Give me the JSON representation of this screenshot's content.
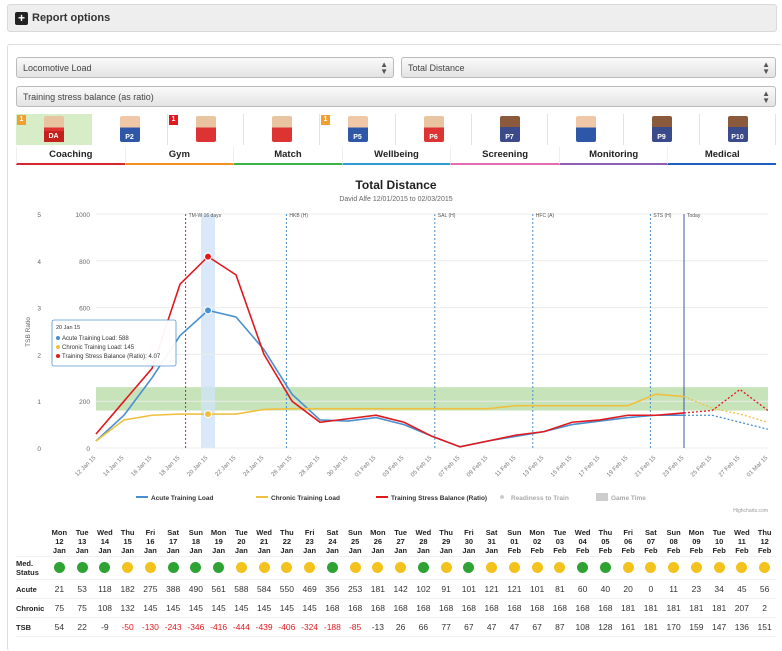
{
  "report_options": {
    "label": "Report options"
  },
  "selectors": {
    "metric": "Locomotive Load",
    "submetric": "Total Distance",
    "analysis": "Training stress balance (as ratio)"
  },
  "players": [
    {
      "badge": "1",
      "badge_color": "#f0a030",
      "tag": "DA",
      "skin": "lt"
    },
    {
      "badge": "",
      "tag": "",
      "num": "P2",
      "skin": "wb"
    },
    {
      "badge": "1",
      "badge_color": "#e0191f",
      "tag": "",
      "num": "",
      "skin": "lt"
    },
    {
      "badge": "",
      "tag": "",
      "num": "",
      "skin": "lt"
    },
    {
      "badge": "1",
      "badge_color": "#f0a030",
      "tag": "",
      "num": "P5",
      "skin": "wb"
    },
    {
      "badge": "",
      "tag": "",
      "num": "P6",
      "skin": "lt"
    },
    {
      "badge": "",
      "tag": "",
      "num": "P7",
      "skin": "dk"
    },
    {
      "badge": "",
      "tag": "",
      "num": "",
      "skin": "wb"
    },
    {
      "badge": "",
      "tag": "",
      "num": "P9",
      "skin": "dk"
    },
    {
      "badge": "",
      "tag": "",
      "num": "P10",
      "skin": "dk"
    }
  ],
  "tabs": [
    {
      "label": "Coaching",
      "color": "#d9272e"
    },
    {
      "label": "Gym",
      "color": "#f29122"
    },
    {
      "label": "Match",
      "color": "#3bb34a"
    },
    {
      "label": "Wellbeing",
      "color": "#2f9bd5"
    },
    {
      "label": "Screening",
      "color": "#e36cb1"
    },
    {
      "label": "Monitoring",
      "color": "#8e5fb0"
    },
    {
      "label": "Medical",
      "color": "#1f5fbf"
    }
  ],
  "chart_data": {
    "type": "line",
    "title": "Total Distance",
    "subtitle": "David Alfe 12/01/2015 to 02/03/2015",
    "ylabel": "TSB Ratio",
    "y_left_ticks": [
      "5",
      "4",
      "3",
      "2",
      "1",
      "0"
    ],
    "y_right_ticks": [
      "1000",
      "800",
      "600",
      "400",
      "200",
      "0"
    ],
    "ylim_left": [
      0,
      5
    ],
    "ylim_right": [
      0,
      1000
    ],
    "x": [
      "12 Jan 15",
      "14 Jan 15",
      "16 Jan 15",
      "18 Jan 15",
      "20 Jan 15",
      "22 Jan 15",
      "24 Jan 15",
      "26 Jan 15",
      "28 Jan 15",
      "30 Jan 15",
      "01 Feb 15",
      "03 Feb 15",
      "05 Feb 15",
      "07 Feb 15",
      "09 Feb 15",
      "11 Feb 15",
      "13 Feb 15",
      "15 Feb 15",
      "17 Feb 15",
      "19 Feb 15",
      "21 Feb 15",
      "23 Feb 15",
      "25 Feb 15",
      "27 Feb 15",
      "01 Mar 15"
    ],
    "series": [
      {
        "name": "Acute Training Load",
        "color": "#4a90d0",
        "values": [
          30,
          140,
          300,
          480,
          588,
          560,
          420,
          230,
          120,
          115,
          130,
          100,
          50,
          5,
          30,
          50,
          70,
          100,
          115,
          130,
          140,
          140,
          140,
          110,
          80
        ]
      },
      {
        "name": "Chronic Training Load",
        "color": "#efc040",
        "values": [
          30,
          120,
          140,
          145,
          145,
          145,
          165,
          168,
          168,
          168,
          168,
          168,
          168,
          168,
          168,
          181,
          181,
          181,
          181,
          181,
          230,
          220,
          170,
          145,
          110
        ]
      },
      {
        "name": "Training Stress Balance (Ratio)",
        "color": "#e0191f",
        "values": [
          60,
          200,
          340,
          700,
          818,
          740,
          400,
          200,
          110,
          125,
          140,
          110,
          50,
          5,
          30,
          55,
          70,
          110,
          120,
          140,
          140,
          150,
          160,
          250,
          160
        ]
      }
    ],
    "legend": [
      "Acute Training Load",
      "Chronic Training Load",
      "Training Stress Balance (Ratio)",
      "Readiness to Train",
      "Game Time"
    ],
    "annotations": [
      "TM-W 16 days",
      "HKB (H)",
      "SAL (H)",
      "HFC (A)",
      "STS (H)",
      "Today"
    ],
    "tooltip": {
      "date": "20 Jan 15",
      "acute": "Acute Training Load: 588",
      "chronic": "Chronic Training Load: 145",
      "tsb": "Training Stress Balance (Ratio): 4.07"
    },
    "credit": "Highcharts.com"
  },
  "table": {
    "days": [
      [
        "Mon",
        "12",
        "Jan"
      ],
      [
        "Tue",
        "13",
        "Jan"
      ],
      [
        "Wed",
        "14",
        "Jan"
      ],
      [
        "Thu",
        "15",
        "Jan"
      ],
      [
        "Fri",
        "16",
        "Jan"
      ],
      [
        "Sat",
        "17",
        "Jan"
      ],
      [
        "Sun",
        "18",
        "Jan"
      ],
      [
        "Mon",
        "19",
        "Jan"
      ],
      [
        "Tue",
        "20",
        "Jan"
      ],
      [
        "Wed",
        "21",
        "Jan"
      ],
      [
        "Thu",
        "22",
        "Jan"
      ],
      [
        "Fri",
        "23",
        "Jan"
      ],
      [
        "Sat",
        "24",
        "Jan"
      ],
      [
        "Sun",
        "25",
        "Jan"
      ],
      [
        "Mon",
        "26",
        "Jan"
      ],
      [
        "Tue",
        "27",
        "Jan"
      ],
      [
        "Wed",
        "28",
        "Jan"
      ],
      [
        "Thu",
        "29",
        "Jan"
      ],
      [
        "Fri",
        "30",
        "Jan"
      ],
      [
        "Sat",
        "31",
        "Jan"
      ],
      [
        "Sun",
        "01",
        "Feb"
      ],
      [
        "Mon",
        "02",
        "Feb"
      ],
      [
        "Tue",
        "03",
        "Feb"
      ],
      [
        "Wed",
        "04",
        "Feb"
      ],
      [
        "Thu",
        "05",
        "Feb"
      ],
      [
        "Fri",
        "06",
        "Feb"
      ],
      [
        "Sat",
        "07",
        "Feb"
      ],
      [
        "Sun",
        "08",
        "Feb"
      ],
      [
        "Mon",
        "09",
        "Feb"
      ],
      [
        "Tue",
        "10",
        "Feb"
      ],
      [
        "Wed",
        "11",
        "Feb"
      ],
      [
        "Thu",
        "12",
        "Feb"
      ]
    ],
    "row_labels": {
      "status": "Med. Status",
      "acute": "Acute",
      "chronic": "Chronic",
      "tsb": "TSB"
    },
    "status": [
      "g",
      "g",
      "g",
      "y",
      "y",
      "g",
      "g",
      "g",
      "y",
      "y",
      "y",
      "y",
      "g",
      "y",
      "y",
      "y",
      "g",
      "y",
      "g",
      "y",
      "y",
      "y",
      "y",
      "g",
      "g",
      "y",
      "y",
      "y",
      "y",
      "y",
      "y",
      "y"
    ],
    "acute": [
      "21",
      "53",
      "118",
      "182",
      "275",
      "388",
      "490",
      "561",
      "588",
      "584",
      "550",
      "469",
      "356",
      "253",
      "181",
      "142",
      "102",
      "91",
      "101",
      "121",
      "121",
      "101",
      "81",
      "60",
      "40",
      "20",
      "0",
      "11",
      "23",
      "34",
      "45",
      "56"
    ],
    "chronic": [
      "75",
      "75",
      "108",
      "132",
      "145",
      "145",
      "145",
      "145",
      "145",
      "145",
      "145",
      "145",
      "168",
      "168",
      "168",
      "168",
      "168",
      "168",
      "168",
      "168",
      "168",
      "168",
      "168",
      "168",
      "168",
      "181",
      "181",
      "181",
      "181",
      "181",
      "207",
      "2"
    ],
    "tsb": [
      "54",
      "22",
      "-9",
      "-50",
      "-130",
      "-243",
      "-346",
      "-416",
      "-444",
      "-439",
      "-406",
      "-324",
      "-188",
      "-85",
      "-13",
      "26",
      "66",
      "77",
      "67",
      "47",
      "47",
      "67",
      "87",
      "108",
      "128",
      "161",
      "181",
      "170",
      "159",
      "147",
      "136",
      "151"
    ]
  }
}
